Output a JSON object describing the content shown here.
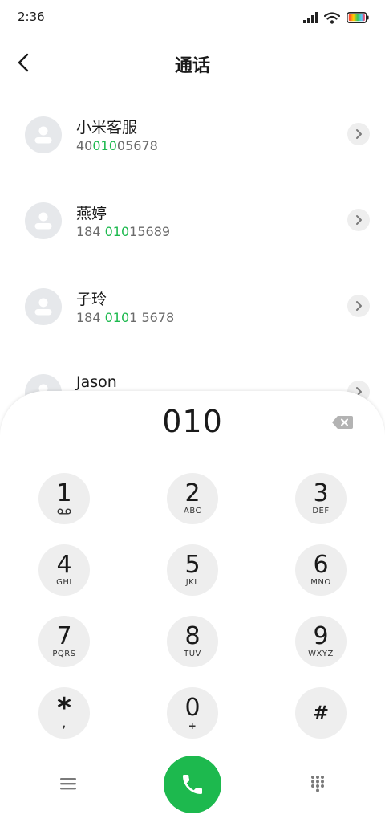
{
  "status_bar": {
    "time": "2:36"
  },
  "header": {
    "title": "通话"
  },
  "contacts": [
    {
      "name": "小米客服",
      "number_pre": "40",
      "number_match": "010",
      "number_post": "05678"
    },
    {
      "name": "燕婷",
      "number_pre": "184 ",
      "number_match": "010",
      "number_post": "15689"
    },
    {
      "name": "子玲",
      "number_pre": "184 ",
      "number_match": "010",
      "number_post": "1 5678"
    },
    {
      "name": "Jason",
      "number_pre": "",
      "number_match": "",
      "number_post": ""
    }
  ],
  "dialer": {
    "input": "010",
    "keys": [
      {
        "digit": "1",
        "letters": "",
        "icon": "voicemail-icon"
      },
      {
        "digit": "2",
        "letters": "ABC"
      },
      {
        "digit": "3",
        "letters": "DEF"
      },
      {
        "digit": "4",
        "letters": "GHI"
      },
      {
        "digit": "5",
        "letters": "JKL"
      },
      {
        "digit": "6",
        "letters": "MNO"
      },
      {
        "digit": "7",
        "letters": "PQRS"
      },
      {
        "digit": "8",
        "letters": "TUV"
      },
      {
        "digit": "9",
        "letters": "WXYZ"
      },
      {
        "digit": "*",
        "letters": ","
      },
      {
        "digit": "0",
        "letters": "+"
      },
      {
        "digit": "#",
        "letters": ""
      }
    ]
  },
  "colors": {
    "accent_green": "#1db94e",
    "key_background": "#eeeeee",
    "avatar_background": "#e6e8eb"
  },
  "icons": {
    "back": "chevron-left-icon",
    "contact_avatar": "person-icon",
    "detail": "chevron-right-icon",
    "backspace": "backspace-icon",
    "menu": "hamburger-menu-icon",
    "call": "phone-icon",
    "keypad": "dialpad-icon"
  }
}
